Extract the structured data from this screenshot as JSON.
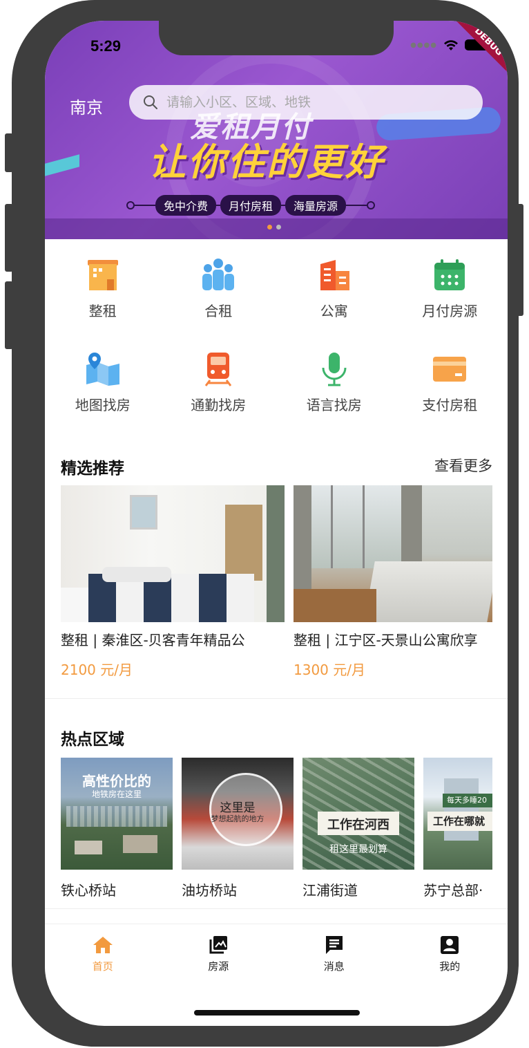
{
  "status": {
    "time": "5:29",
    "debug_label": "DEBUG"
  },
  "header": {
    "city": "南京",
    "search_placeholder": "请输入小区、区域、地铁"
  },
  "banner": {
    "line1": "爱租月付",
    "line2": "让你住的更好",
    "tags": [
      "免中介费",
      "月付房租",
      "海量房源"
    ],
    "dots": 2,
    "active_dot": 0
  },
  "menu": [
    {
      "label": "整租",
      "icon": "building-icon"
    },
    {
      "label": "合租",
      "icon": "people-icon"
    },
    {
      "label": "公寓",
      "icon": "apartment-icon"
    },
    {
      "label": "月付房源",
      "icon": "calendar-icon"
    },
    {
      "label": "地图找房",
      "icon": "map-icon"
    },
    {
      "label": "通勤找房",
      "icon": "train-icon"
    },
    {
      "label": "语言找房",
      "icon": "microphone-icon"
    },
    {
      "label": "支付房租",
      "icon": "card-icon"
    }
  ],
  "recommend": {
    "title": "精选推荐",
    "more": "查看更多",
    "items": [
      {
        "title": "整租 | 秦淮区-贝客青年精品公",
        "price": "2100 元/月"
      },
      {
        "title": "整租 | 江宁区-天景山公寓欣享",
        "price": "1300 元/月"
      }
    ]
  },
  "hot": {
    "title": "热点区域",
    "items": [
      {
        "label": "铁心桥站",
        "cap1": "高性价比的",
        "cap2": "地铁房在这里"
      },
      {
        "label": "油坊桥站",
        "cap1": "这里是",
        "cap2": "梦想起航的地方"
      },
      {
        "label": "江浦街道",
        "cap1": "工作在河西",
        "cap2": "租这里最划算"
      },
      {
        "label": "苏宁总部·",
        "cap1": "工作在哪就",
        "cap2": "每天多睡20"
      }
    ]
  },
  "tabs": [
    {
      "label": "首页",
      "icon": "home-icon"
    },
    {
      "label": "房源",
      "icon": "photo-library-icon"
    },
    {
      "label": "消息",
      "icon": "message-icon"
    },
    {
      "label": "我的",
      "icon": "account-icon"
    }
  ],
  "colors": {
    "accent": "#f29a3f",
    "banner": "#8a4cc6",
    "frame": "#3e3e3e"
  }
}
